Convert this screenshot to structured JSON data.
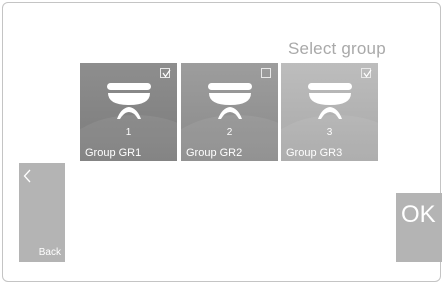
{
  "header": {
    "title": "Select group"
  },
  "groups": [
    {
      "number": "1",
      "label": "Group GR1",
      "checked": true,
      "bg": "#8e8e8e"
    },
    {
      "number": "2",
      "label": "Group GR2",
      "checked": false,
      "bg": "#9d9d9d"
    },
    {
      "number": "3",
      "label": "Group GR3",
      "checked": true,
      "bg": "#bdbdbd"
    }
  ],
  "nav": {
    "back_label": "Back",
    "back_icon": "chevron-left-icon",
    "ok_label": "OK"
  },
  "colors": {
    "button_bg": "#b4b4b4",
    "title": "#a9a9a9"
  }
}
